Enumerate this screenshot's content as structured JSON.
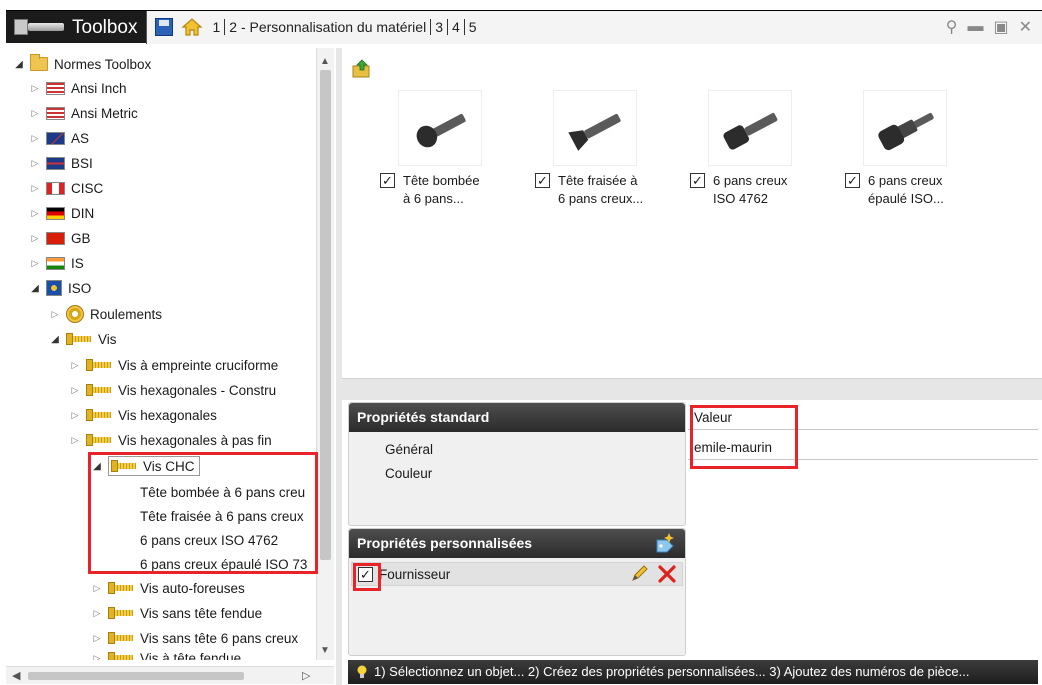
{
  "window": {
    "title": "Toolbox",
    "breadcrumbs": [
      "1",
      "2 - Personnalisation du matériel",
      "3",
      "4",
      "5"
    ],
    "window_icons": [
      "help-icon",
      "minimize-icon",
      "restore-icon",
      "close-icon"
    ]
  },
  "tree": {
    "root": "Normes Toolbox",
    "standards": [
      "Ansi Inch",
      "Ansi Metric",
      "AS",
      "BSI",
      "CISC",
      "DIN",
      "GB",
      "IS",
      "ISO"
    ],
    "iso_children": [
      "Roulements",
      "Vis"
    ],
    "vis_children": [
      "Vis à empreinte cruciforme",
      "Vis hexagonales - Constru",
      "Vis hexagonales",
      "Vis hexagonales à pas fin",
      "Vis CHC"
    ],
    "vis_chc_children": [
      "Tête bombée à 6 pans creu",
      "Tête fraisée à 6 pans creux",
      "6 pans creux ISO 4762",
      "6 pans creux épaulé ISO 73"
    ],
    "vis_after": [
      "Vis auto-foreuses",
      "Vis sans tête fendue",
      "Vis sans tête 6 pans creux",
      "Vis à tête fendue"
    ]
  },
  "parts": [
    {
      "label_line1": "Tête bombée",
      "label_line2": "à 6 pans...",
      "checked": true
    },
    {
      "label_line1": "Tête fraisée à",
      "label_line2": "6 pans creux...",
      "checked": true
    },
    {
      "label_line1": "6 pans creux",
      "label_line2": "ISO 4762",
      "checked": true
    },
    {
      "label_line1": "6 pans creux",
      "label_line2": "épaulé ISO...",
      "checked": true
    }
  ],
  "standard_props": {
    "header": "Propriétés standard",
    "items": [
      "Général",
      "Couleur"
    ]
  },
  "value_column": {
    "header": "Valeur",
    "value": "emile-maurin"
  },
  "custom_props": {
    "header": "Propriétés personnalisées",
    "rows": [
      {
        "label": "Fournisseur",
        "checked": true
      }
    ]
  },
  "status": {
    "text": "1) Sélectionnez un objet... 2) Créez des propriétés personnalisées... 3) Ajoutez des numéros de pièce..."
  },
  "colors": {
    "highlight": "#e8232a",
    "titlebar": "#1b1b1b",
    "group_header": "#2b2b2b"
  }
}
